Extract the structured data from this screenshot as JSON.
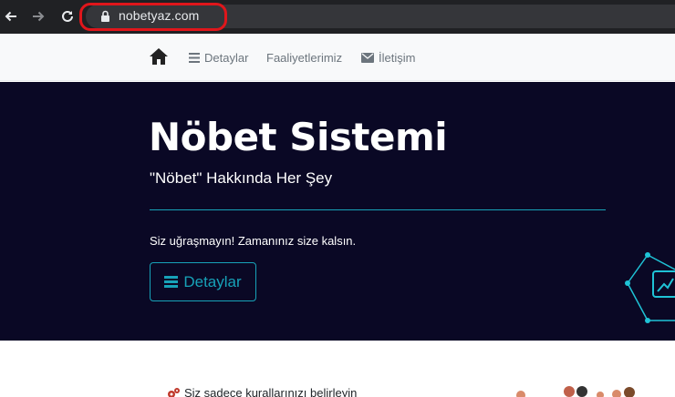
{
  "browser": {
    "url": "nobetyaz.com"
  },
  "navbar": {
    "items": [
      {
        "label": "Detaylar",
        "icon": "bars-icon"
      },
      {
        "label": "Faaliyetlerimiz"
      },
      {
        "label": "İletişim",
        "icon": "envelope-icon"
      }
    ]
  },
  "hero": {
    "title": "Nöbet Sistemi",
    "subtitle": "\"Nöbet\" Hakkında Her Şey",
    "text": "Siz uğraşmayın! Zamanınız size kalsın.",
    "button_label": "Detaylar"
  },
  "content": {
    "first_line": "Siz sadece kurallarınızı belirleyin"
  },
  "colors": {
    "hero_bg": "#0a0825",
    "accent": "#17a2b8",
    "annotation": "#e0161b"
  }
}
